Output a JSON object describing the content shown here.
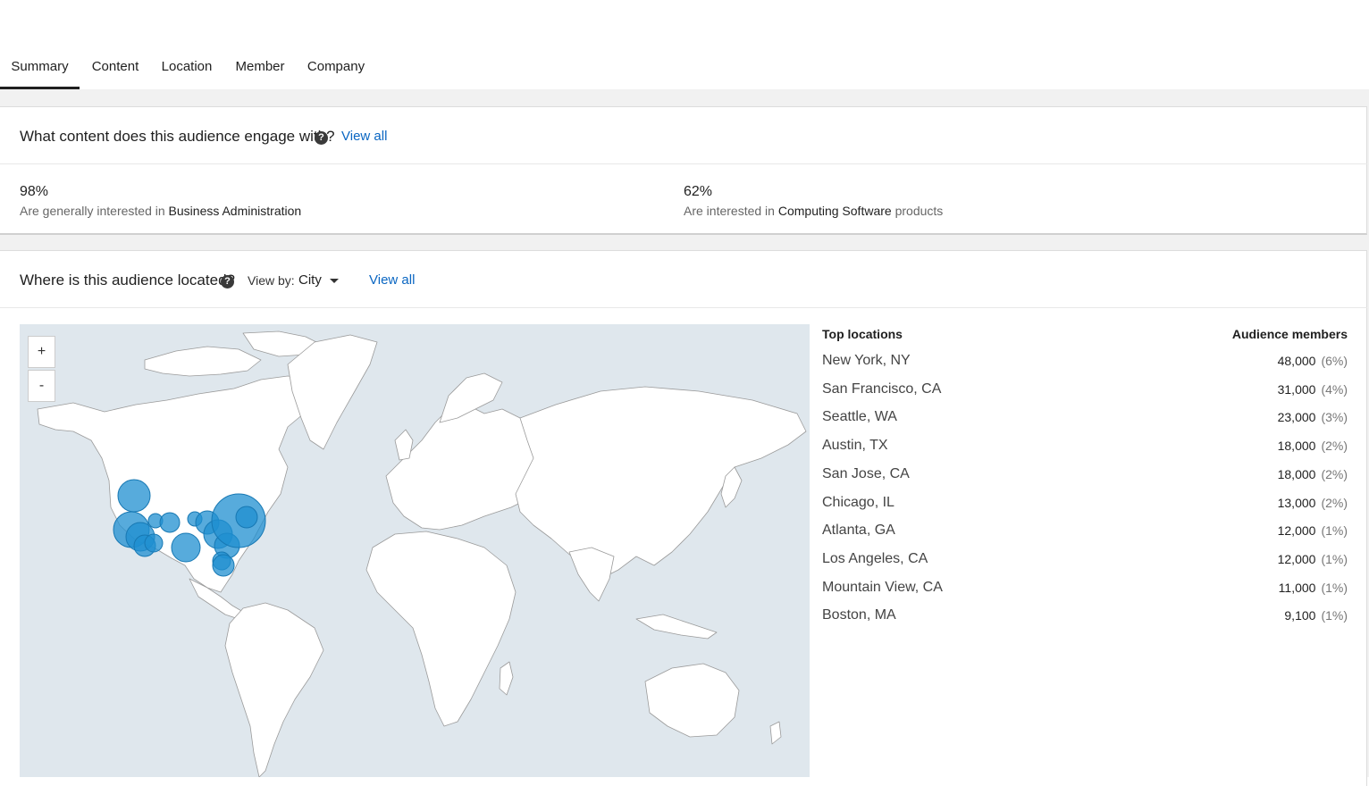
{
  "tabs": [
    {
      "label": "Summary",
      "active": true
    },
    {
      "label": "Content",
      "active": false
    },
    {
      "label": "Location",
      "active": false
    },
    {
      "label": "Member",
      "active": false
    },
    {
      "label": "Company",
      "active": false
    }
  ],
  "content_section": {
    "title": "What content does this audience engage with?",
    "help_icon": "?",
    "view_all": "View all",
    "stats": [
      {
        "percent": "98%",
        "prefix": "Are generally interested in",
        "topic": "Business Administration",
        "suffix": ""
      },
      {
        "percent": "62%",
        "prefix": "Are interested in",
        "topic": "Computing Software",
        "suffix": "products"
      }
    ]
  },
  "location_section": {
    "title": "Where is this audience located?",
    "help_icon": "?",
    "view_by_label": "View by:",
    "view_by_value": "City",
    "view_all": "View all",
    "map": {
      "zoom_in": "+",
      "zoom_out": "-",
      "bubble_color": "#1f8fd0"
    },
    "table": {
      "col_location": "Top locations",
      "col_members": "Audience members",
      "rows": [
        {
          "location": "New York, NY",
          "members": "48,000",
          "percent": "(6%)"
        },
        {
          "location": "San Francisco, CA",
          "members": "31,000",
          "percent": "(4%)"
        },
        {
          "location": "Seattle, WA",
          "members": "23,000",
          "percent": "(3%)"
        },
        {
          "location": "Austin, TX",
          "members": "18,000",
          "percent": "(2%)"
        },
        {
          "location": "San Jose, CA",
          "members": "18,000",
          "percent": "(2%)"
        },
        {
          "location": "Chicago, IL",
          "members": "13,000",
          "percent": "(2%)"
        },
        {
          "location": "Atlanta, GA",
          "members": "12,000",
          "percent": "(1%)"
        },
        {
          "location": "Los Angeles, CA",
          "members": "12,000",
          "percent": "(1%)"
        },
        {
          "location": "Mountain View, CA",
          "members": "11,000",
          "percent": "(1%)"
        },
        {
          "location": "Boston, MA",
          "members": "9,100",
          "percent": "(1%)"
        }
      ]
    }
  }
}
